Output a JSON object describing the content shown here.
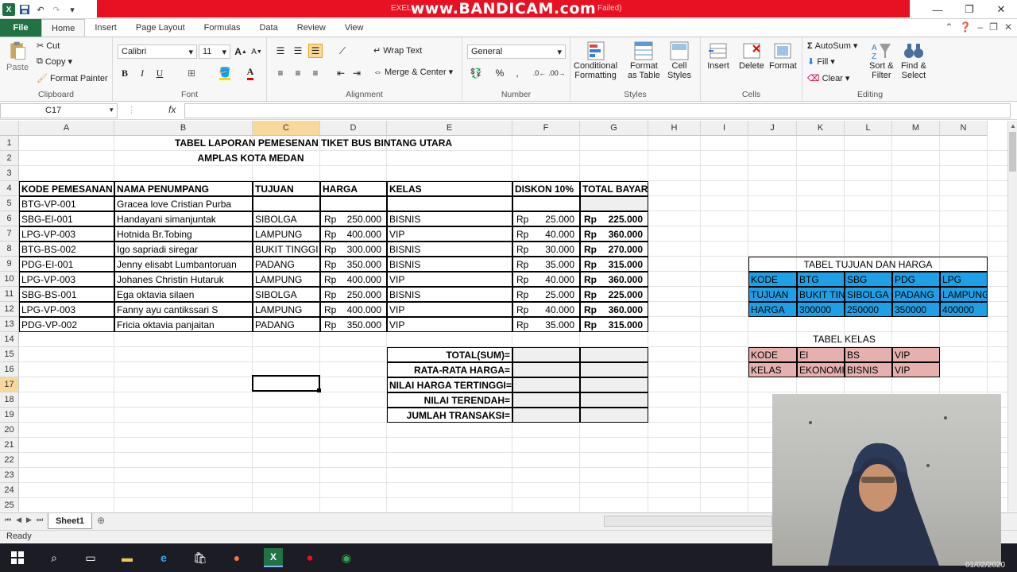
{
  "window": {
    "recorder_brand": "www.BANDICAM.com",
    "banner_left": "EXEL",
    "banner_right": "Failed)"
  },
  "tabs": {
    "file": "File",
    "items": [
      "Home",
      "Insert",
      "Page Layout",
      "Formulas",
      "Data",
      "Review",
      "View"
    ]
  },
  "ribbon": {
    "clipboard": {
      "label": "Clipboard",
      "paste": "Paste",
      "cut": "Cut",
      "copy": "Copy",
      "format_painter": "Format Painter"
    },
    "font": {
      "label": "Font",
      "name": "Calibri",
      "size": "11"
    },
    "alignment": {
      "label": "Alignment",
      "wrap": "Wrap Text",
      "merge": "Merge & Center"
    },
    "number": {
      "label": "Number",
      "format": "General"
    },
    "styles": {
      "label": "Styles",
      "cond1": "Conditional",
      "cond2": "Formatting",
      "fmt1": "Format",
      "fmt2": "as Table",
      "cell1": "Cell",
      "cell2": "Styles"
    },
    "cells": {
      "label": "Cells",
      "insert": "Insert",
      "delete": "Delete",
      "format": "Format"
    },
    "editing": {
      "label": "Editing",
      "autosum": "AutoSum",
      "fill": "Fill",
      "clear": "Clear",
      "sort1": "Sort &",
      "sort2": "Filter",
      "find1": "Find &",
      "find2": "Select"
    }
  },
  "formula_bar": {
    "name_box": "C17",
    "fx": "fx",
    "formula": ""
  },
  "columns": [
    "A",
    "B",
    "C",
    "D",
    "E",
    "F",
    "G",
    "H",
    "I",
    "J",
    "K",
    "L",
    "M",
    "N"
  ],
  "rows": [
    "1",
    "2",
    "3",
    "4",
    "5",
    "6",
    "7",
    "8",
    "9",
    "10",
    "11",
    "12",
    "13",
    "14",
    "15",
    "16",
    "17",
    "18",
    "19",
    "20",
    "21",
    "22",
    "23",
    "24",
    "25"
  ],
  "sheet": {
    "title1": "TABEL LAPORAN PEMESENAN TIKET BUS BINTANG UTARA",
    "title2": "AMPLAS KOTA MEDAN",
    "headers": [
      "KODE PEMESANAN",
      "NAMA PENUMPANG",
      "TUJUAN",
      "HARGA",
      "KELAS",
      "DISKON 10%",
      "TOTAL BAYAR"
    ],
    "currency": "Rp",
    "data": [
      {
        "kode": "BTG-VP-001",
        "nama": "Gracea love Cristian Purba",
        "tujuan": "",
        "harga": "",
        "kelas": "",
        "diskon": "",
        "total": ""
      },
      {
        "kode": "SBG-EI-001",
        "nama": "Handayani simanjuntak",
        "tujuan": "SIBOLGA",
        "harga": "250.000",
        "kelas": "BISNIS",
        "diskon": "25.000",
        "total": "225.000"
      },
      {
        "kode": "LPG-VP-003",
        "nama": "Hotnida Br.Tobing",
        "tujuan": "LAMPUNG",
        "harga": "400.000",
        "kelas": "VIP",
        "diskon": "40.000",
        "total": "360.000"
      },
      {
        "kode": "BTG-BS-002",
        "nama": "Igo sapriadi siregar",
        "tujuan": "BUKIT TINGGI",
        "harga": "300.000",
        "kelas": "BISNIS",
        "diskon": "30.000",
        "total": "270.000"
      },
      {
        "kode": "PDG-EI-001",
        "nama": "Jenny elisabt Lumbantoruan",
        "tujuan": "PADANG",
        "harga": "350.000",
        "kelas": "BISNIS",
        "diskon": "35.000",
        "total": "315.000"
      },
      {
        "kode": "LPG-VP-003",
        "nama": "Johanes Christin Hutaruk",
        "tujuan": "LAMPUNG",
        "harga": "400.000",
        "kelas": "VIP",
        "diskon": "40.000",
        "total": "360.000"
      },
      {
        "kode": "SBG-BS-001",
        "nama": "Ega oktavia silaen",
        "tujuan": "SIBOLGA",
        "harga": "250.000",
        "kelas": "BISNIS",
        "diskon": "25.000",
        "total": "225.000"
      },
      {
        "kode": "LPG-VP-003",
        "nama": "Fanny ayu cantikssari S",
        "tujuan": "LAMPUNG",
        "harga": "400.000",
        "kelas": "VIP",
        "diskon": "40.000",
        "total": "360.000"
      },
      {
        "kode": "PDG-VP-002",
        "nama": "Fricia oktavia panjaitan",
        "tujuan": "PADANG",
        "harga": "350.000",
        "kelas": "VIP",
        "diskon": "35.000",
        "total": "315.000"
      }
    ],
    "summary": [
      "TOTAL(SUM)=",
      "RATA-RATA HARGA=",
      "NILAI HARGA TERTINGGI=",
      "NILAI TERENDAH=",
      "JUMLAH TRANSAKSI="
    ],
    "tujuan_table": {
      "title": "TABEL TUJUAN DAN HARGA",
      "rows": [
        [
          "KODE",
          "BTG",
          "SBG",
          "PDG",
          "LPG"
        ],
        [
          "TUJUAN",
          "BUKIT TIN",
          "SIBOLGA",
          "PADANG",
          "LAMPUNG"
        ],
        [
          "HARGA",
          "300000",
          "250000",
          "350000",
          "400000"
        ]
      ]
    },
    "kelas_table": {
      "title": "TABEL KELAS",
      "rows": [
        [
          "KODE",
          "EI",
          "BS",
          "VIP"
        ],
        [
          "KELAS",
          "EKONOMI",
          "BISNIS",
          "VIP"
        ]
      ]
    }
  },
  "sheet_tab": "Sheet1",
  "status": "Ready",
  "webcam_date": "01/02/2020",
  "colors": {
    "excel_green": "#217346",
    "recording_red": "#e81123",
    "tujuan_fill": "#1fa0e6",
    "kelas_fill": "#e6b0ae"
  }
}
